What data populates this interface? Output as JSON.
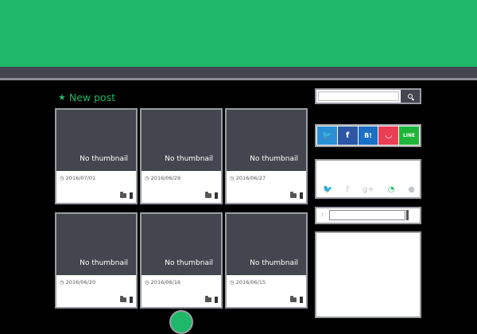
{
  "section": {
    "title": "New post",
    "icon": "star-icon"
  },
  "posts": [
    {
      "thumb": "No thumbnail",
      "date": "2016/07/01"
    },
    {
      "thumb": "No thumbnail",
      "date": "2016/06/29"
    },
    {
      "thumb": "No thumbnail",
      "date": "2016/06/27"
    },
    {
      "thumb": "No thumbnail",
      "date": "2016/06/20"
    },
    {
      "thumb": "No thumbnail",
      "date": "2016/06/16"
    },
    {
      "thumb": "No thumbnail",
      "date": "2016/06/15"
    }
  ],
  "share_buttons": [
    {
      "name": "twitter",
      "glyph": "🐦",
      "color": "#2b8fd6"
    },
    {
      "name": "facebook",
      "glyph": "f",
      "color": "#2d57a6"
    },
    {
      "name": "hatena",
      "glyph": "B!",
      "color": "#1b6fc6"
    },
    {
      "name": "pocket",
      "glyph": "◡",
      "color": "#ea3e54"
    },
    {
      "name": "line",
      "glyph": "LINE",
      "color": "#1fb53b"
    }
  ],
  "follow_icons": [
    "twitter-icon",
    "facebook-icon",
    "google-plus-icon",
    "rss-icon",
    "line-icon"
  ],
  "archive": {
    "prefix": ":"
  },
  "colors": {
    "accent": "#1fb868",
    "nav": "#43464e",
    "background": "#000000"
  }
}
